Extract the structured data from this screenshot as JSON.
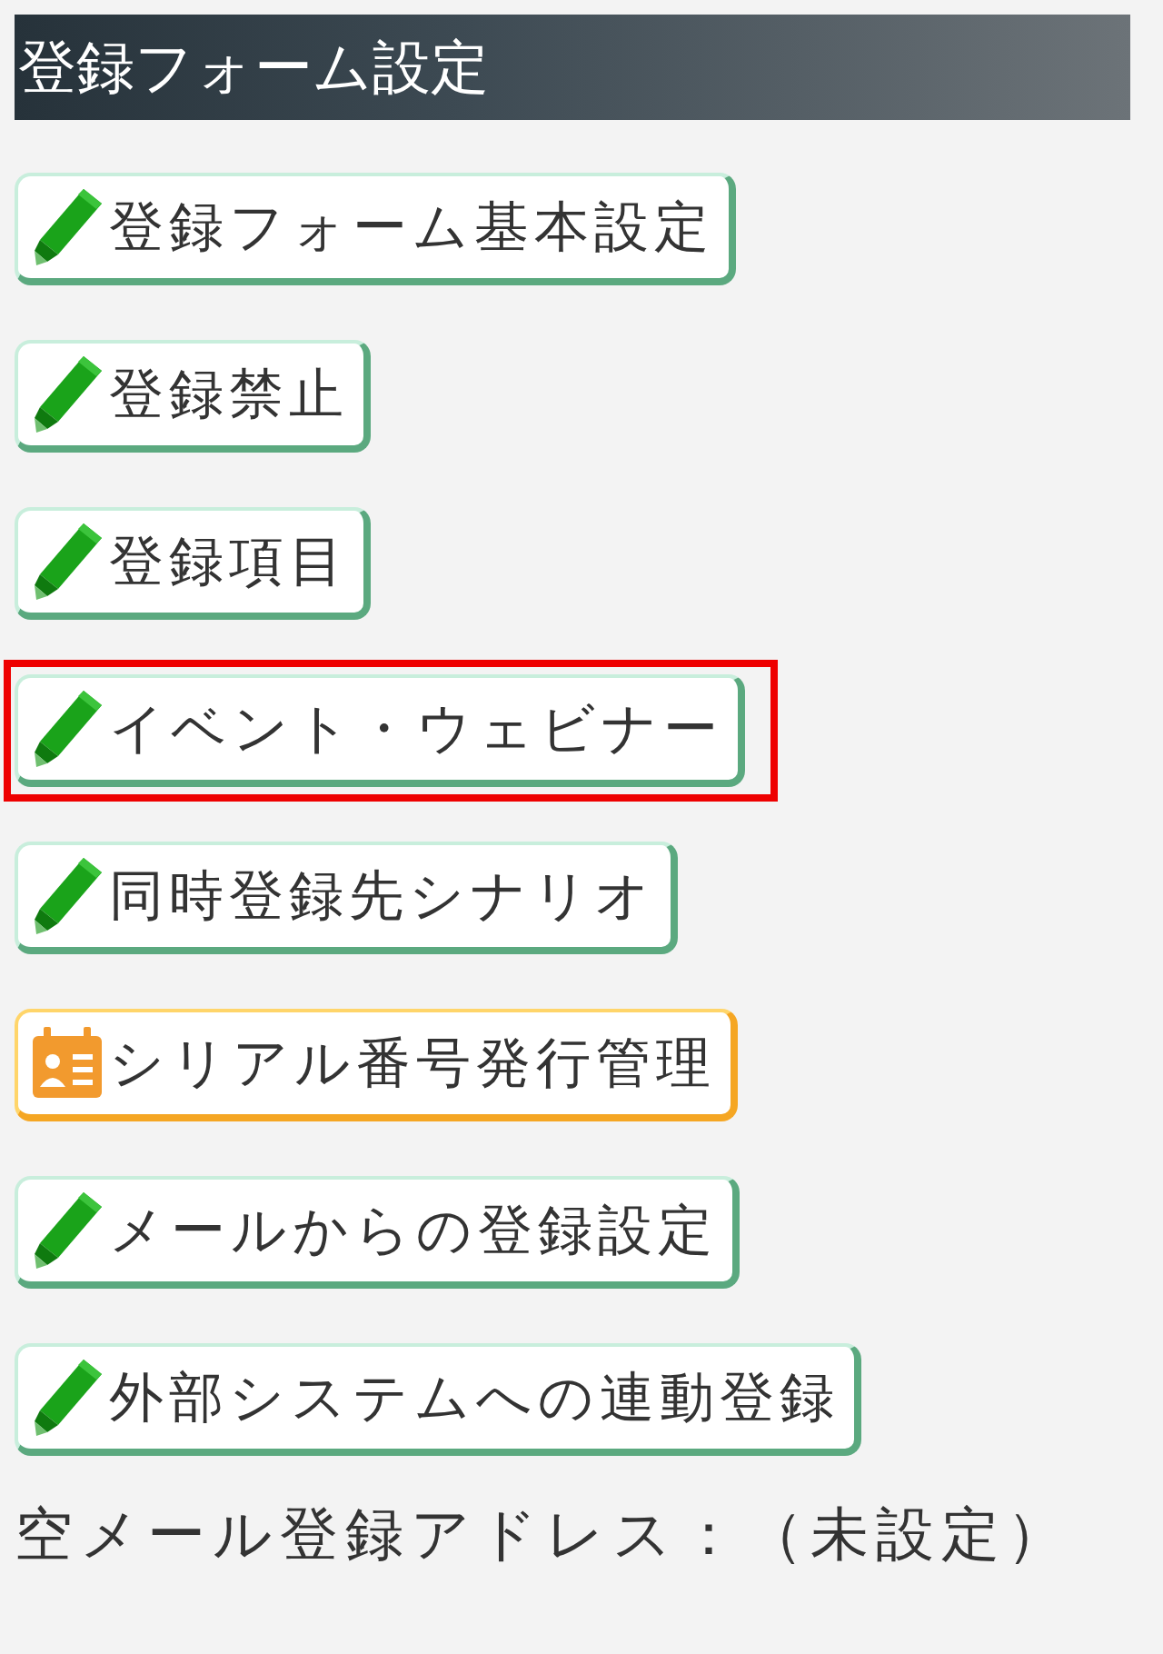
{
  "header": {
    "title": "登録フォーム設定"
  },
  "buttons": [
    {
      "label": "登録フォーム基本設定",
      "kind": "edit",
      "highlighted": false
    },
    {
      "label": "登録禁止",
      "kind": "edit",
      "highlighted": false
    },
    {
      "label": "登録項目",
      "kind": "edit",
      "highlighted": false
    },
    {
      "label": "イベント・ウェビナー",
      "kind": "edit",
      "highlighted": true
    },
    {
      "label": "同時登録先シナリオ",
      "kind": "edit",
      "highlighted": false
    },
    {
      "label": "シリアル番号発行管理",
      "kind": "serial",
      "highlighted": false
    },
    {
      "label": "メールからの登録設定",
      "kind": "edit",
      "highlighted": false
    },
    {
      "label": "外部システムへの連動登録",
      "kind": "edit",
      "highlighted": false
    }
  ],
  "footer": {
    "text": "空メール登録アドレス：（未設定）"
  }
}
